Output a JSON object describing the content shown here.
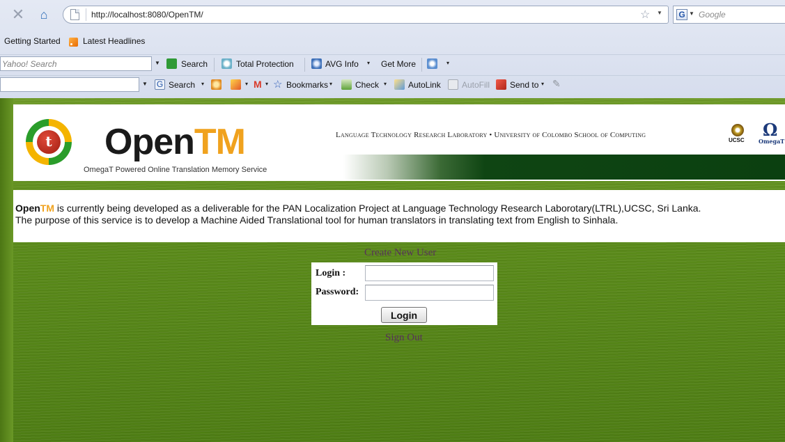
{
  "browser": {
    "url": "http://localhost:8080/OpenTM/",
    "search_placeholder": "Google",
    "bookmarks": [
      "Getting Started",
      "Latest Headlines"
    ]
  },
  "toolbar_yahoo": {
    "placeholder": "Yahoo! Search",
    "items": [
      "Search",
      "Total Protection",
      "AVG Info",
      "Get More"
    ]
  },
  "toolbar_google": {
    "items": [
      "Search",
      "Bookmarks",
      "Check",
      "AutoLink",
      "AutoFill",
      "Send to"
    ]
  },
  "header": {
    "logo_open": "Open",
    "logo_tm": "TM",
    "logo_glyph": "t",
    "subtitle": "OmegaT Powered Online Translation Memory Service",
    "lab_line": "Language Technology Research Laboratory • University of Colombo School of Computing",
    "ucsc": "UCSC",
    "omega_symbol": "Ω",
    "omega_label": "OmegaT"
  },
  "intro": {
    "brand_open": "Open",
    "brand_tm": "TM",
    "line1": " is currently being developed as a deliverable for the PAN Localization Project at Language Technology Research Laborotary(LTRL),UCSC, Sri Lanka.",
    "line2": "The purpose of this service is to develop a Machine Aided Translational tool for human translators in translating text from English to Sinhala."
  },
  "auth": {
    "create_user": "Create New User",
    "login_label": "Login :",
    "password_label": "Password:",
    "login_button": "Login",
    "sign_out": "Sign Out"
  }
}
